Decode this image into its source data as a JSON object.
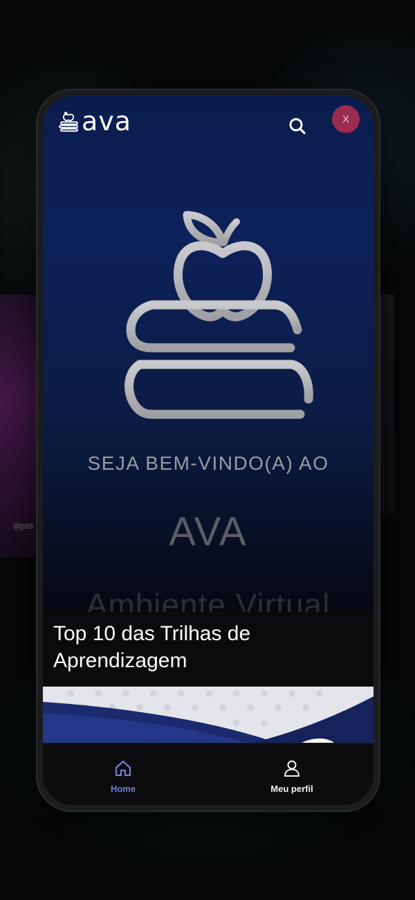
{
  "header": {
    "logo_text": "ava",
    "search_icon": "search-icon",
    "avatar_initial": "X"
  },
  "hero": {
    "icon": "apple-on-books-icon",
    "welcome_text": "SEJA BEM-VINDO(A) AO",
    "brand_text": "AVA",
    "subtitle_partial": "Ambiente Virtual"
  },
  "section": {
    "title": "Top 10 das Trilhas de Aprendizagem"
  },
  "bottom_nav": {
    "items": [
      {
        "label": "Home",
        "icon": "home-icon",
        "active": true
      },
      {
        "label": "Meu perfil",
        "icon": "user-icon",
        "active": false
      }
    ]
  },
  "background": {
    "tag_text": "@gam"
  },
  "colors": {
    "accent": "#6f80d8",
    "avatar_bg": "#9b2c4f",
    "screen_top": "#0b1d4e",
    "screen_bottom": "#050506"
  }
}
